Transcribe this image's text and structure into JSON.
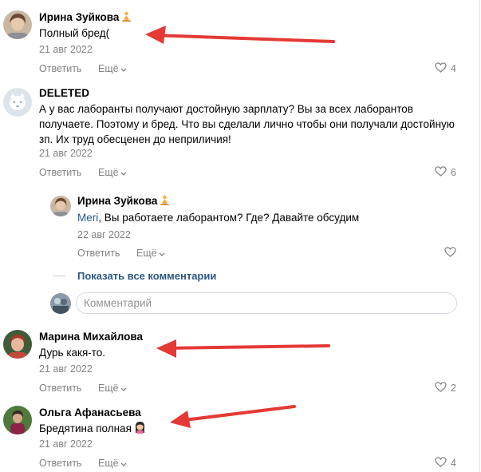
{
  "comments": [
    {
      "author": "Ирина Зуйкова",
      "text": "Полный бред(",
      "date": "21 авг 2022",
      "reply_label": "Ответить",
      "more_label": "Ещё",
      "likes": "4"
    },
    {
      "author": "DELETED",
      "text": "А у вас лаборанты получают достойную зарплату? Вы за всех лаборантов получаете. Поэтому и бред. Что вы сделали лично чтобы они получали достойную зп. Их труд обесценен до неприличия!",
      "date": "21 авг 2022",
      "reply_label": "Ответить",
      "more_label": "Ещё",
      "likes": "6"
    },
    {
      "author": "Марина Михайлова",
      "text": "Дурь какя-то.",
      "date": "21 авг 2022",
      "reply_label": "Ответить",
      "more_label": "Ещё",
      "likes": "2"
    },
    {
      "author": "Ольга Афанасьева",
      "text": "Бредятина полная",
      "date": "21 авг 2022",
      "reply_label": "Ответить",
      "more_label": "Ещё",
      "likes": "4"
    }
  ],
  "reply": {
    "author": "Ирина Зуйкова",
    "mention": "Meri",
    "text": ", Вы работаете лаборантом? Где? Давайте обсудим",
    "date": "22 авг 2022",
    "reply_label": "Ответить",
    "more_label": "Ещё"
  },
  "show_all_label": "Показать все комментарии",
  "comment_input": {
    "placeholder": "Комментарий"
  },
  "colors": {
    "link": "#2a5885",
    "muted": "#828282",
    "arrow": "#e53935"
  },
  "icons": [
    "meditation-emoji-icon",
    "heart-icon",
    "chevron-down-icon",
    "woman-emoji-icon",
    "deleted-dog-avatar-icon"
  ]
}
